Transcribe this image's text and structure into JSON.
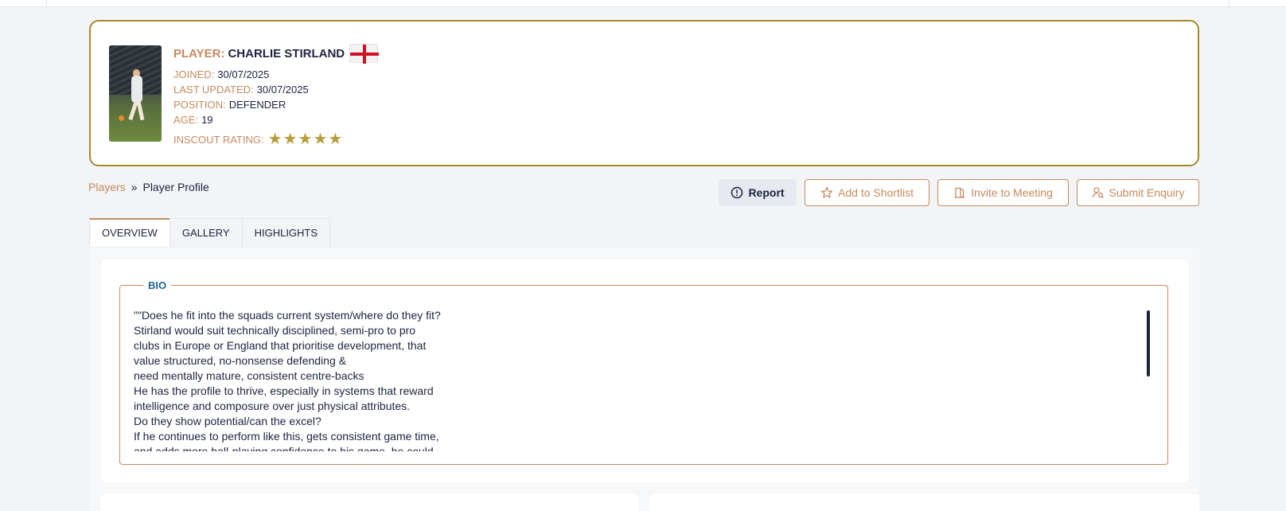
{
  "player": {
    "label": "PLAYER:",
    "name": "CHARLIE STIRLAND",
    "flag": "england-flag",
    "photo_alt": "player-photo",
    "fields": [
      {
        "label": "JOINED:",
        "value": "30/07/2025"
      },
      {
        "label": "LAST UPDATED:",
        "value": "30/07/2025"
      },
      {
        "label": "POSITION:",
        "value": "DEFENDER"
      },
      {
        "label": "AGE:",
        "value": "19"
      }
    ],
    "rating_label": "INSCOUT RATING:",
    "rating_stars": 5,
    "rating_max": 5,
    "star_glyph": "★"
  },
  "breadcrumb": {
    "link": "Players",
    "separator": "»",
    "current": "Player Profile"
  },
  "actions": {
    "report": "Report",
    "shortlist": "Add to Shortlist",
    "meeting": "Invite to Meeting",
    "enquiry": "Submit Enquiry"
  },
  "tabs": [
    {
      "label": "OVERVIEW",
      "active": true
    },
    {
      "label": "GALLERY",
      "active": false
    },
    {
      "label": "HIGHLIGHTS",
      "active": false
    }
  ],
  "bio": {
    "legend": "BIO",
    "lines": [
      "\"\"Does he fit into the squads current system/where do they fit?",
      "Stirland would suit technically disciplined, semi-pro to pro",
      "clubs in Europe or England that prioritise development, that",
      "value structured, no-nonsense defending &",
      "need mentally mature, consistent centre-backs",
      "He has the profile to thrive, especially in systems that reward",
      "intelligence and composure over just physical attributes.",
      "Do they show potential/can the excel?",
      "If he continues to perform like this, gets consistent game time,",
      "and adds more ball-playing confidence to his game, he could"
    ]
  },
  "colors": {
    "accent": "#c68a5e",
    "card_border": "#a58a2c",
    "navy": "#1c2340",
    "star": "#b69d3a",
    "legend": "#1f6790"
  }
}
